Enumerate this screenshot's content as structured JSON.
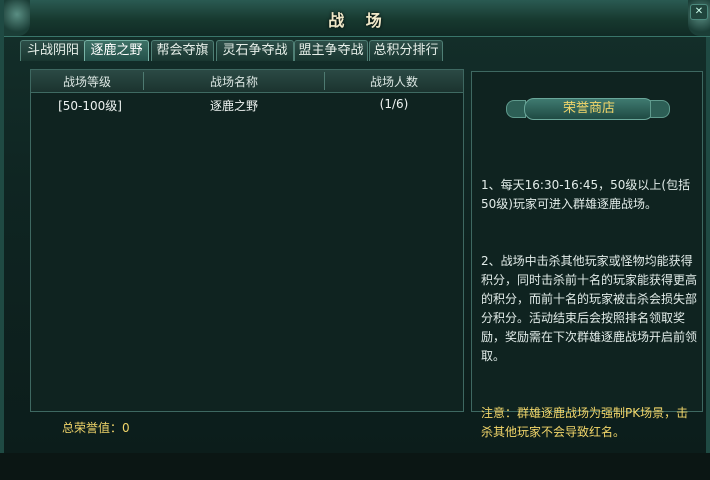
{
  "window": {
    "title": "战 场",
    "close_label": "✕"
  },
  "tabs": [
    {
      "label": "斗战阴阳",
      "active": false
    },
    {
      "label": "逐鹿之野",
      "active": true
    },
    {
      "label": "帮会夺旗",
      "active": false
    },
    {
      "label": "灵石争夺战",
      "active": false
    },
    {
      "label": "盟主争夺战",
      "active": false
    },
    {
      "label": "总积分排行",
      "active": false
    }
  ],
  "table": {
    "headers": [
      "战场等级",
      "战场名称",
      "战场人数"
    ],
    "rows": [
      {
        "level": "[50-100级]",
        "name": "逐鹿之野",
        "count": "(1/6)"
      }
    ]
  },
  "footer": {
    "honor_label": "总荣誉值：",
    "honor_value": "0"
  },
  "shop": {
    "button_label": "荣誉商店"
  },
  "description": {
    "p1": "1、每天16:30-16:45，50级以上(包括50级)玩家可进入群雄逐鹿战场。",
    "p2": "2、战场中击杀其他玩家或怪物均能获得积分，同时击杀前十名的玩家能获得更高的积分，而前十名的玩家被击杀会损失部分积分。活动结束后会按照排名领取奖励，奖励需在下次群雄逐鹿战场开启前领取。",
    "note": "注意：群雄逐鹿战场为强制PK场景，击杀其他玩家不会导致红名。"
  },
  "colors": {
    "accent_gold": "#f2d66a",
    "panel_bg": "#0f2320",
    "border": "#3e6861"
  }
}
